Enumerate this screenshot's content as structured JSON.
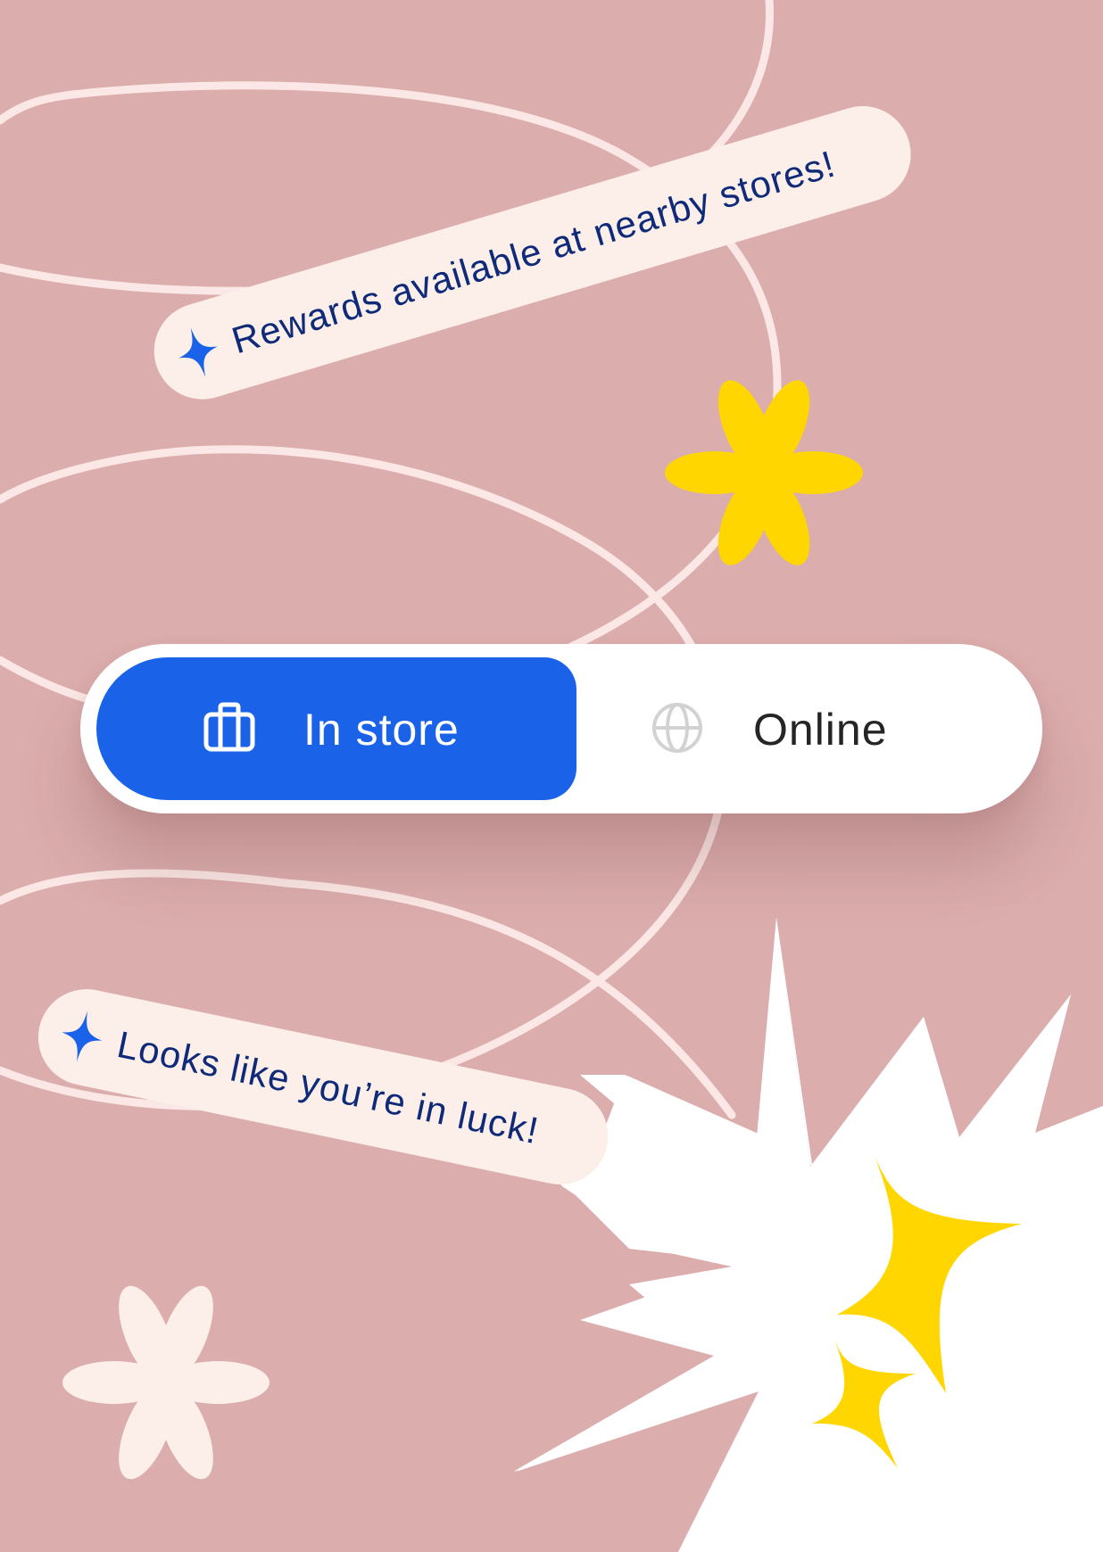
{
  "colors": {
    "background": "#dcadad",
    "accent_blue": "#1a62e8",
    "tag_fill": "#fcefe9",
    "tag_text": "#0e2a78",
    "yellow": "#ffd600",
    "white": "#ffffff"
  },
  "tags": {
    "top": {
      "text": "Rewards available at nearby stores!",
      "icon": "sparkle-icon"
    },
    "bottom": {
      "text": "Looks like you’re in luck!",
      "icon": "sparkle-icon"
    }
  },
  "toggle": {
    "selected": "in_store",
    "in_store": {
      "label": "In store",
      "icon": "briefcase-icon"
    },
    "online": {
      "label": "Online",
      "icon": "globe-icon"
    }
  }
}
